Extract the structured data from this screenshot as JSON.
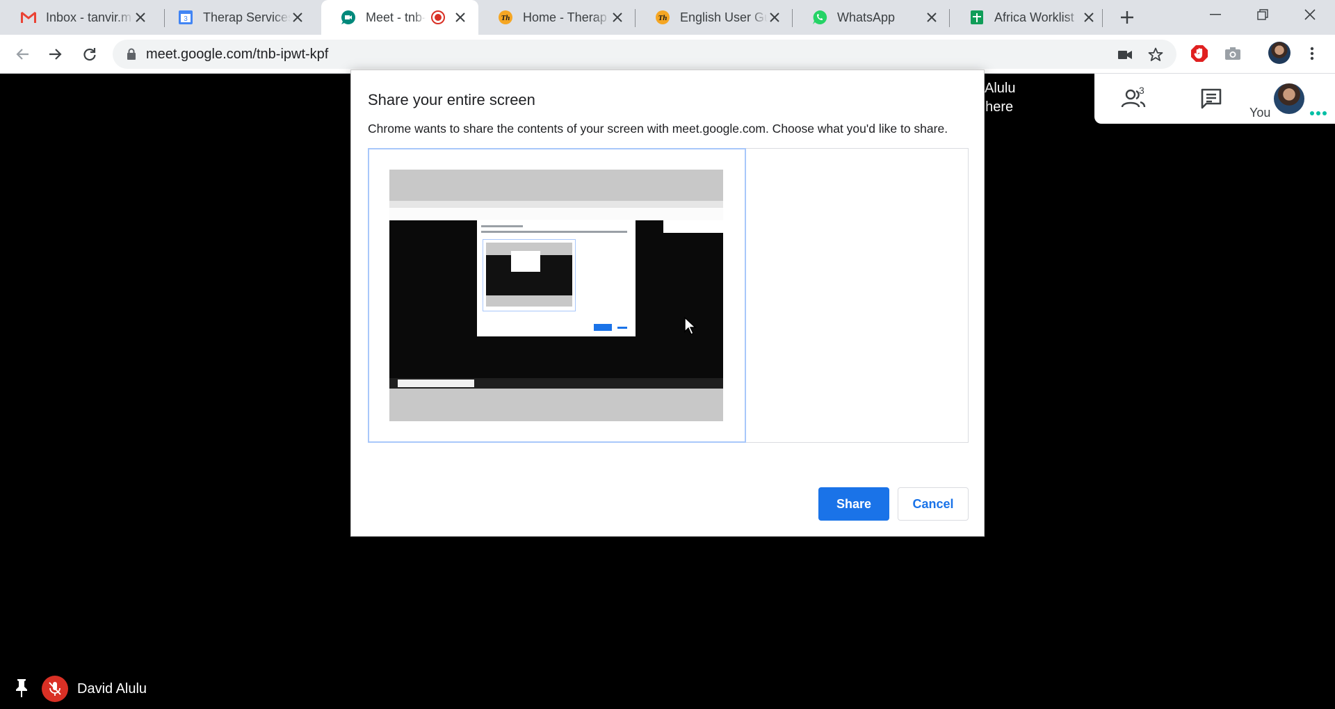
{
  "browser": {
    "tabs": [
      {
        "title": "Inbox - tanvir.m",
        "icon": "gmail-icon",
        "active": false
      },
      {
        "title": "Therap Services",
        "icon": "calendar-icon",
        "active": false
      },
      {
        "title": "Meet - tnb-i",
        "icon": "meet-icon",
        "active": true
      },
      {
        "title": "Home - Therap",
        "icon": "therap-icon",
        "active": false
      },
      {
        "title": "English User Gui",
        "icon": "therap-icon",
        "active": false
      },
      {
        "title": "WhatsApp",
        "icon": "whatsapp-icon",
        "active": false
      },
      {
        "title": "Africa Worklist",
        "icon": "sheets-icon",
        "active": false
      }
    ],
    "calendar_badge": "3",
    "url": "meet.google.com/tnb-ipwt-kpf"
  },
  "meet": {
    "banner_line1": "vid Alulu",
    "banner_line2": "lso here",
    "participant_count": "3",
    "you_label": "You",
    "presenter_name": "David Alulu"
  },
  "dialog": {
    "title": "Share your entire screen",
    "description": "Chrome wants to share the contents of your screen with meet.google.com. Choose what you'd like to share.",
    "share_label": "Share",
    "cancel_label": "Cancel"
  },
  "colors": {
    "accent": "#1a73e8",
    "mute_red": "#d93025",
    "record_red": "#d93025",
    "meet_green": "#00897b"
  }
}
